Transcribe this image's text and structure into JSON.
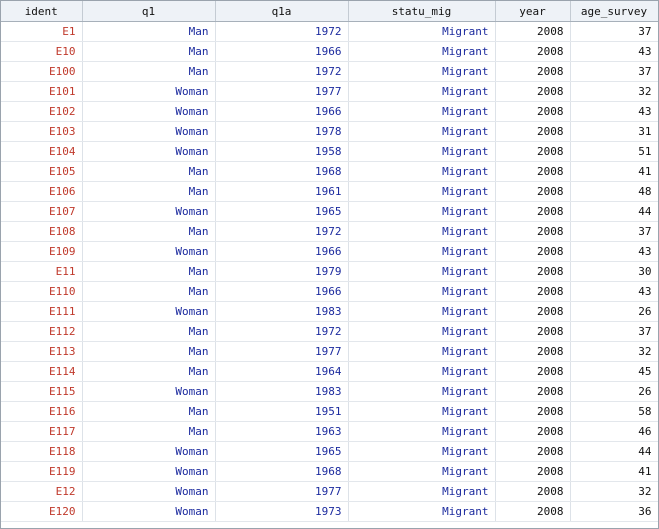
{
  "columns": [
    "ident",
    "q1",
    "q1a",
    "statu_mig",
    "year",
    "age_survey"
  ],
  "rows": [
    [
      "E1",
      "Man",
      "1972",
      "Migrant",
      "2008",
      "37"
    ],
    [
      "E10",
      "Man",
      "1966",
      "Migrant",
      "2008",
      "43"
    ],
    [
      "E100",
      "Man",
      "1972",
      "Migrant",
      "2008",
      "37"
    ],
    [
      "E101",
      "Woman",
      "1977",
      "Migrant",
      "2008",
      "32"
    ],
    [
      "E102",
      "Woman",
      "1966",
      "Migrant",
      "2008",
      "43"
    ],
    [
      "E103",
      "Woman",
      "1978",
      "Migrant",
      "2008",
      "31"
    ],
    [
      "E104",
      "Woman",
      "1958",
      "Migrant",
      "2008",
      "51"
    ],
    [
      "E105",
      "Man",
      "1968",
      "Migrant",
      "2008",
      "41"
    ],
    [
      "E106",
      "Man",
      "1961",
      "Migrant",
      "2008",
      "48"
    ],
    [
      "E107",
      "Woman",
      "1965",
      "Migrant",
      "2008",
      "44"
    ],
    [
      "E108",
      "Man",
      "1972",
      "Migrant",
      "2008",
      "37"
    ],
    [
      "E109",
      "Woman",
      "1966",
      "Migrant",
      "2008",
      "43"
    ],
    [
      "E11",
      "Man",
      "1979",
      "Migrant",
      "2008",
      "30"
    ],
    [
      "E110",
      "Man",
      "1966",
      "Migrant",
      "2008",
      "43"
    ],
    [
      "E111",
      "Woman",
      "1983",
      "Migrant",
      "2008",
      "26"
    ],
    [
      "E112",
      "Man",
      "1972",
      "Migrant",
      "2008",
      "37"
    ],
    [
      "E113",
      "Man",
      "1977",
      "Migrant",
      "2008",
      "32"
    ],
    [
      "E114",
      "Man",
      "1964",
      "Migrant",
      "2008",
      "45"
    ],
    [
      "E115",
      "Woman",
      "1983",
      "Migrant",
      "2008",
      "26"
    ],
    [
      "E116",
      "Man",
      "1951",
      "Migrant",
      "2008",
      "58"
    ],
    [
      "E117",
      "Man",
      "1963",
      "Migrant",
      "2008",
      "46"
    ],
    [
      "E118",
      "Woman",
      "1965",
      "Migrant",
      "2008",
      "44"
    ],
    [
      "E119",
      "Woman",
      "1968",
      "Migrant",
      "2008",
      "41"
    ],
    [
      "E12",
      "Woman",
      "1977",
      "Migrant",
      "2008",
      "32"
    ],
    [
      "E120",
      "Woman",
      "1973",
      "Migrant",
      "2008",
      "36"
    ]
  ],
  "colors": {
    "string_value": "#c0392b",
    "labeled_value": "#1b2a9e",
    "numeric_value": "#111111",
    "header_bg": "#eef2f7"
  }
}
